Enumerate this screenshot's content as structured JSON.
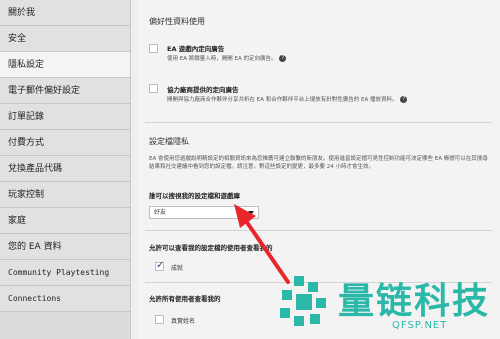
{
  "sidebar": {
    "items": [
      {
        "label": "關於我"
      },
      {
        "label": "安全"
      },
      {
        "label": "隱私設定"
      },
      {
        "label": "電子郵件偏好設定"
      },
      {
        "label": "訂單記錄"
      },
      {
        "label": "付費方式"
      },
      {
        "label": "兌換產品代碼"
      },
      {
        "label": "玩家控制"
      },
      {
        "label": "家庭"
      },
      {
        "label": "您的 EA 資料"
      },
      {
        "label": "Community Playtesting"
      },
      {
        "label": "Connections"
      }
    ],
    "active_index": 2
  },
  "preferences": {
    "title": "偏好性資料使用",
    "option1": {
      "title": "EA 遊戲內定向廣告",
      "desc": "使用 EA 將鎖量入時，開開 EA 的定向廣告。"
    },
    "option2": {
      "title": "協力廠商提供的定向廣告",
      "desc": "開開與協力廠商合作夥伴分享共析在 EA 和合作夥伴平台上搜放有針對性廣告的 EA 播放資料。"
    }
  },
  "visibility": {
    "title": "設定檔隱私",
    "paragraph": "EA 會使用您遊戲說明精設定的相關資訊來為您推薦可建立聯繫的新朋友。使用進皆設定檔可見性控制功能可決定哪些 EA 帳號可以在其搜尋結果和社交建議中看到您的設定檔。請注意，對這些設定的變更，最多要 24 小時才會生效。",
    "who_can_see_label": "誰可以搜視我的設定檔和遊戲庫",
    "select_value": "好友",
    "allow_real_name_label": "允許可以查看我的設定檔的使用者查看我的",
    "checkbox_label": "成就",
    "allow_all_label": "允許所有使用者查看我的",
    "real_name_label": "真實姓名"
  },
  "watermark": {
    "text": "量链科技",
    "sub": "QFSP.NET"
  },
  "colors": {
    "accent": "#5a2a8c",
    "arrow": "#e8262b",
    "watermark": "#2bb8a8"
  }
}
